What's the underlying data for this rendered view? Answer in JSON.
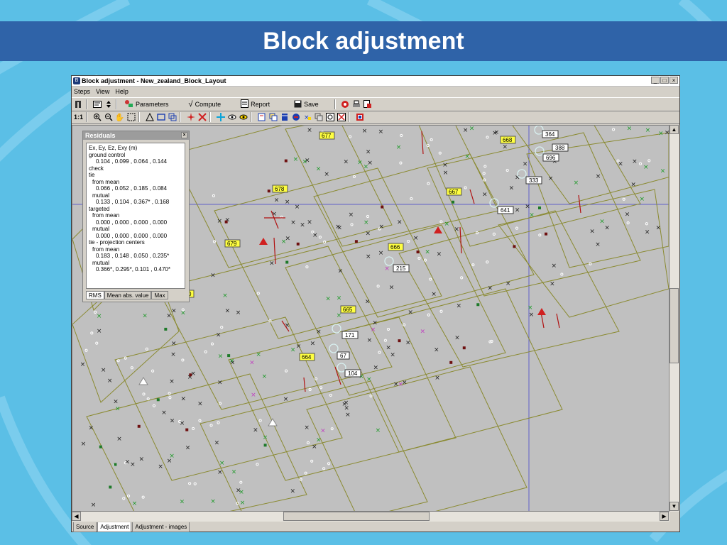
{
  "slide": {
    "title": "Block adjustment"
  },
  "window": {
    "title": "Block adjustment - New_zealand_Block_Layout",
    "controls": [
      "_",
      "□",
      "×"
    ]
  },
  "menu": {
    "items": [
      "Steps",
      "View",
      "Help"
    ]
  },
  "toolbar1": {
    "parameters_label": "Parameters",
    "compute_label": "Compute",
    "report_label": "Report",
    "save_label": "Save"
  },
  "toolbar2": {
    "zoom_label": "1:1"
  },
  "residuals": {
    "title": "Residuals",
    "header": "Ex, Ey, Ez, Exy (m)",
    "ground_control_label": "ground control",
    "ground_control_values": "0.104 , 0.099 , 0.064 , 0.144",
    "check_label": "check",
    "tie_label": "tie",
    "tie_from_mean_label": "from mean",
    "tie_from_mean_values": "0.066 , 0.052 , 0.185 , 0.084",
    "tie_mutual_label": "mutual",
    "tie_mutual_values": "0.133 , 0.104 , 0.367* , 0.168",
    "targeted_label": "targeted",
    "targeted_from_mean_label": "from mean",
    "targeted_from_mean_values": "0.000 , 0.000 , 0.000 , 0.000",
    "targeted_mutual_label": "mutual",
    "targeted_mutual_values": "0.000 , 0.000 , 0.000 , 0.000",
    "tie_pc_label": "tie - projection centers",
    "tie_pc_from_mean_label": "from mean",
    "tie_pc_from_mean_values": "0.183 , 0.148 , 0.050 , 0.235*",
    "tie_pc_mutual_label": "mutual",
    "tie_pc_mutual_values": "0.366*, 0.295*, 0.101 , 0.470*",
    "tabs": [
      "RMS",
      "Mean abs. value",
      "Max"
    ]
  },
  "map": {
    "image_labels": [
      "677",
      "668",
      "678",
      "667",
      "679",
      "666",
      "665",
      "664",
      "0"
    ],
    "point_labels": [
      "364",
      "388",
      "696",
      "333",
      "641",
      "215",
      "171",
      "67",
      "104"
    ]
  },
  "bottom_tabs": [
    "Source",
    "Adjustment",
    "Adjustment - images"
  ]
}
